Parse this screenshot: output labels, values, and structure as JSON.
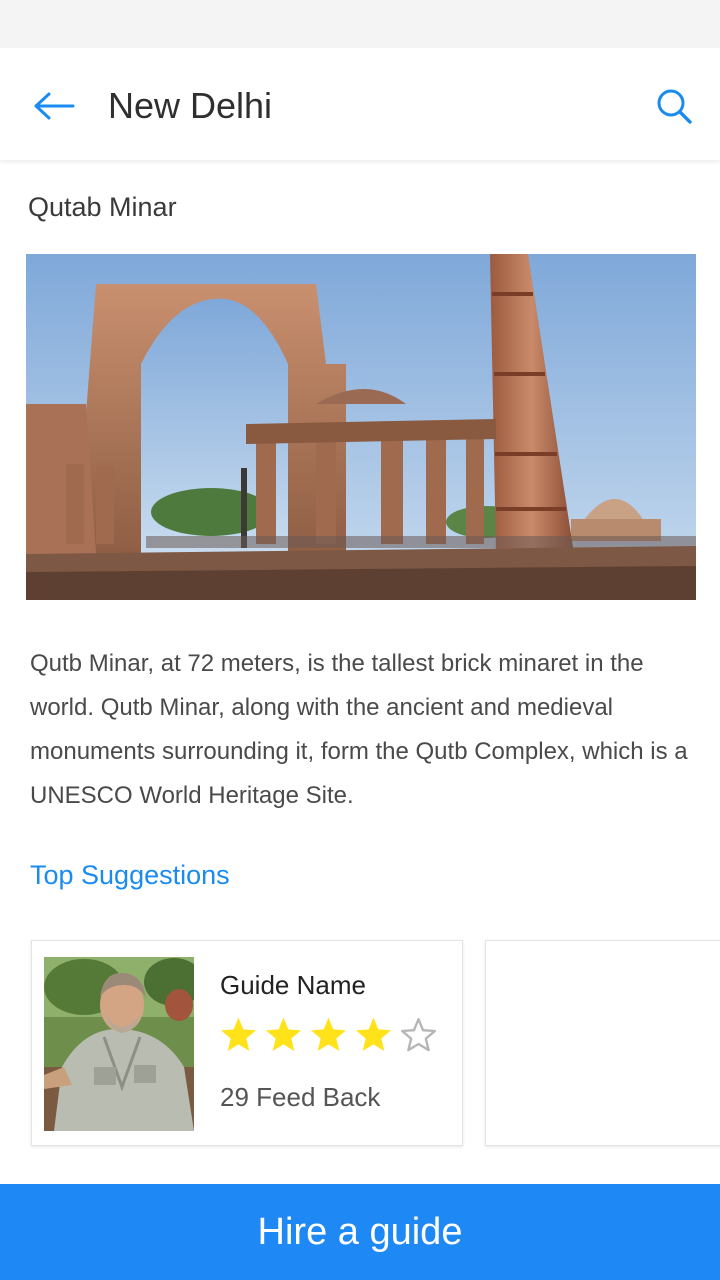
{
  "header": {
    "title": "New Delhi",
    "back_icon": "arrow-left-icon",
    "search_icon": "search-icon"
  },
  "place": {
    "name": "Qutab Minar",
    "description": "Qutb Minar, at 72 meters, is the tallest brick minaret in the world. Qutb Minar, along with the ancient and medieval monuments surrounding it, form the Qutb Complex, which is a UNESCO World Heritage Site."
  },
  "suggestions": {
    "title": "Top Suggestions",
    "guides": [
      {
        "name": "Guide Name",
        "rating": 4,
        "max_rating": 5,
        "feedback": "29 Feed Back"
      }
    ]
  },
  "cta": {
    "label": "Hire a guide"
  },
  "colors": {
    "accent": "#1a8bf0",
    "cta_background": "#1e88f5",
    "star_filled": "#ffe21a",
    "star_empty": "#b5b5b5"
  }
}
